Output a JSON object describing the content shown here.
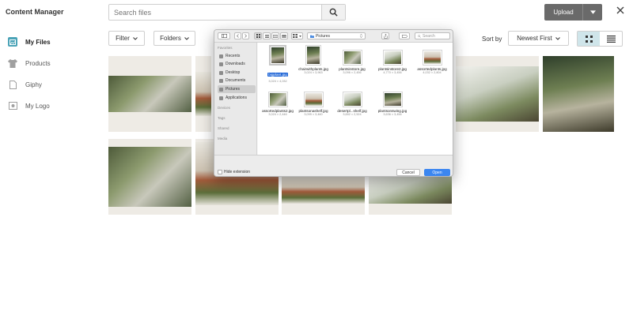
{
  "header": {
    "title": "Content Manager",
    "search_placeholder": "Search files",
    "upload_label": "Upload"
  },
  "sidebar": {
    "items": [
      {
        "label": "My Files",
        "icon": "my-files-icon",
        "active": true
      },
      {
        "label": "Products",
        "icon": "tshirt-icon",
        "active": false
      },
      {
        "label": "Giphy",
        "icon": "document-icon",
        "active": false
      },
      {
        "label": "My Logo",
        "icon": "image-icon",
        "active": false
      }
    ]
  },
  "toolbar": {
    "filter_label": "Filter",
    "folders_label": "Folders",
    "sort_by_label": "Sort by",
    "sort_value": "Newest First"
  },
  "dialog": {
    "location": "Pictures",
    "search_placeholder": "Search",
    "sidebar": {
      "favorites_header": "Favorites",
      "favorites": [
        "Recents",
        "Downloads",
        "Desktop",
        "Documents",
        "Pictures",
        "Applications"
      ],
      "devices_header": "Devices",
      "tags_header": "Tags",
      "shared_header": "Shared",
      "media_header": "Media",
      "selected": "Pictures"
    },
    "files": [
      {
        "name": "bigplant.jpg",
        "dims": "3,024 × 4,032",
        "selected": true
      },
      {
        "name": "chairwithplants.jpg",
        "dims": "3,024 × 3,963",
        "selected": false
      },
      {
        "name": "plantsinstore.jpg",
        "dims": "3,096 × 2,456",
        "selected": false
      },
      {
        "name": "plantsinstore2.jpg",
        "dims": "4,770 × 3,456",
        "selected": false
      },
      {
        "name": "assortedplants.jpg",
        "dims": "4,032 × 2,804",
        "selected": false
      },
      {
        "name": "assortedplants2.jpg",
        "dims": "3,024 × 2,446",
        "selected": false
      },
      {
        "name": "plantsonashelf.jpg",
        "dims": "3,099 × 3,460",
        "selected": false
      },
      {
        "name": "desertpl...shelf.jpg",
        "dims": "3,652 × 2,524",
        "selected": false
      },
      {
        "name": "plantsonswing.jpg",
        "dims": "3,636 × 3,456",
        "selected": false
      }
    ],
    "hide_extension_label": "Hide extension",
    "cancel_label": "Cancel",
    "open_label": "Open"
  }
}
